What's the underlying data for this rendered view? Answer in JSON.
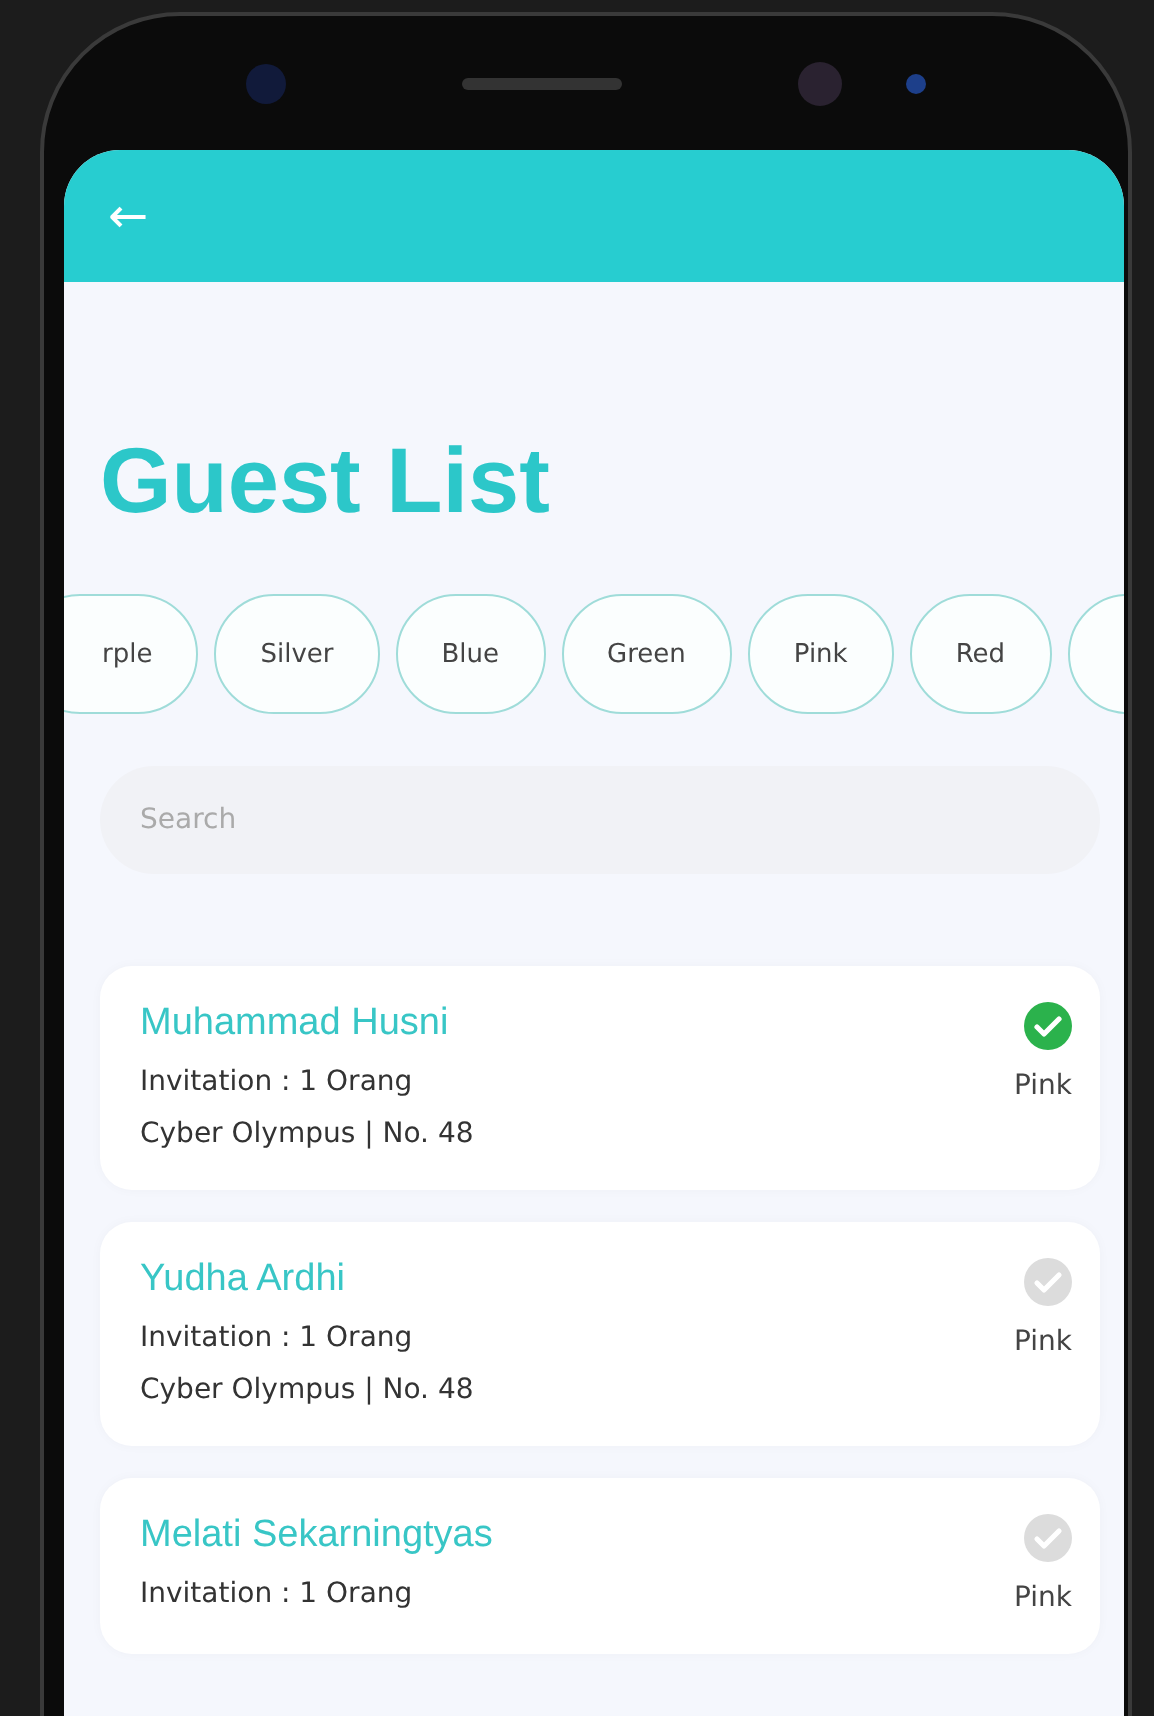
{
  "header": {
    "back": "←"
  },
  "title": "Guest List",
  "chips": [
    "rple",
    "Silver",
    "Blue",
    "Green",
    "Pink",
    "Red"
  ],
  "search": {
    "placeholder": "Search"
  },
  "guests": [
    {
      "name": "Muhammad Husni",
      "invitation": "Invitation : 1 Orang",
      "place": "Cyber Olympus | No. 48",
      "category": "Pink",
      "checked": true
    },
    {
      "name": "Yudha Ardhi",
      "invitation": "Invitation : 1 Orang",
      "place": "Cyber Olympus | No. 48",
      "category": "Pink",
      "checked": false
    },
    {
      "name": "Melati Sekarningtyas",
      "invitation": "Invitation : 1 Orang",
      "category": "Pink",
      "checked": false
    }
  ]
}
